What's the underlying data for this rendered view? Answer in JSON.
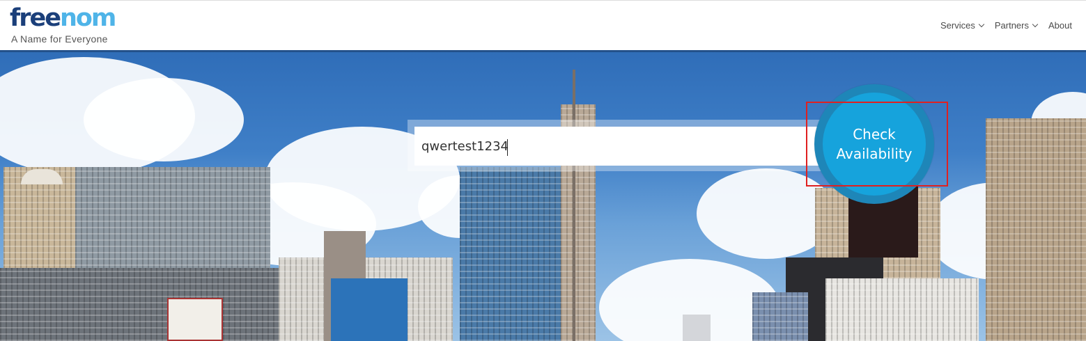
{
  "header": {
    "logo": {
      "part1": "free",
      "part2": "nom"
    },
    "tagline": "A Name for Everyone",
    "nav": [
      {
        "label": "Services"
      },
      {
        "label": "Partners"
      },
      {
        "label": "About"
      }
    ]
  },
  "search": {
    "value": "qwertest1234"
  },
  "check_button": {
    "line1": "Check",
    "line2": "Availability"
  },
  "colors": {
    "logo_dark": "#1b3f7a",
    "logo_accent": "#4fb4e8",
    "button": "#16a3dc",
    "button_ring": "#1e86b8",
    "highlight": "#e02020"
  },
  "icons": [
    "chevron-down-icon"
  ]
}
